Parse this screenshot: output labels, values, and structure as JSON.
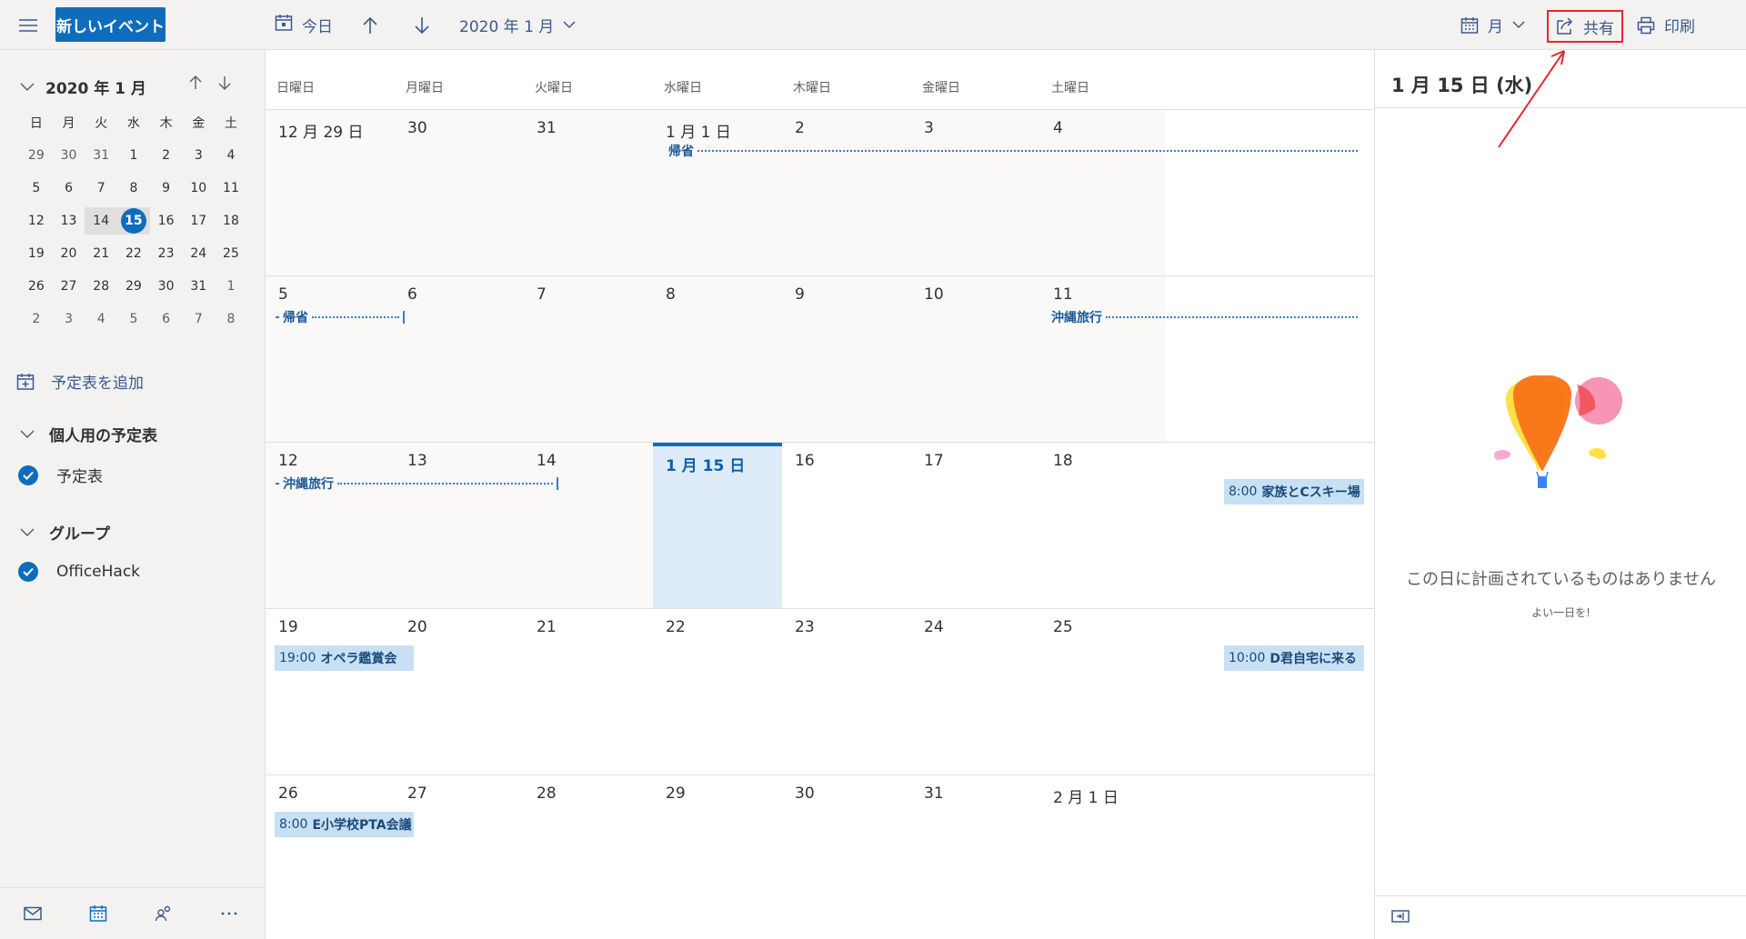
{
  "toolbar": {
    "new_event": "新しいイベント",
    "today": "今日",
    "month_label": "2020 年 1 月",
    "view": "月",
    "share": "共有",
    "print": "印刷"
  },
  "mini_calendar": {
    "title": "2020 年 1 月",
    "weekdays": [
      "日",
      "月",
      "火",
      "水",
      "木",
      "金",
      "土"
    ],
    "weeks": [
      [
        "29",
        "30",
        "31",
        "1",
        "2",
        "3",
        "4"
      ],
      [
        "5",
        "6",
        "7",
        "8",
        "9",
        "10",
        "11"
      ],
      [
        "12",
        "13",
        "14",
        "15",
        "16",
        "17",
        "18"
      ],
      [
        "19",
        "20",
        "21",
        "22",
        "23",
        "24",
        "25"
      ],
      [
        "26",
        "27",
        "28",
        "29",
        "30",
        "31",
        "1"
      ],
      [
        "2",
        "3",
        "4",
        "5",
        "6",
        "7",
        "8"
      ]
    ],
    "selected_day": "15"
  },
  "sidebar": {
    "add_calendar": "予定表を追加",
    "group_personal": "個人用の予定表",
    "calendar_item": "予定表",
    "group_groups": "グループ",
    "group_item": "OfficeHack"
  },
  "calendar": {
    "weekday_headers": [
      "日曜日",
      "月曜日",
      "火曜日",
      "水曜日",
      "木曜日",
      "金曜日",
      "土曜日"
    ],
    "weeks": [
      [
        "12 月 29 日",
        "30",
        "31",
        "1 月 1 日",
        "2",
        "3",
        "4"
      ],
      [
        "5",
        "6",
        "7",
        "8",
        "9",
        "10",
        "11"
      ],
      [
        "12",
        "13",
        "14",
        "1 月 15 日",
        "16",
        "17",
        "18"
      ],
      [
        "19",
        "20",
        "21",
        "22",
        "23",
        "24",
        "25"
      ],
      [
        "26",
        "27",
        "28",
        "29",
        "30",
        "31",
        "2 月 1 日"
      ]
    ],
    "events": {
      "kisei": "帰省",
      "okinawa": "沖縄旅行",
      "ski_time": "8:00",
      "ski_title": "家族とCスキー場",
      "opera_time": "19:00",
      "opera_title": "オペラ鑑賞会",
      "d_time": "10:00",
      "d_title": "D君自宅に来る",
      "pta_time": "8:00",
      "pta_title": "E小学校PTA会議"
    }
  },
  "details": {
    "date": "1 月 15 日 (水)",
    "empty_message": "この日に計画されているものはありません",
    "empty_sub": "よい一日を!"
  },
  "colors": {
    "accent": "#0f6cbd",
    "event_fill": "#c7e0f4",
    "today_fill": "#deecf9",
    "annotation": "#e6262e"
  }
}
